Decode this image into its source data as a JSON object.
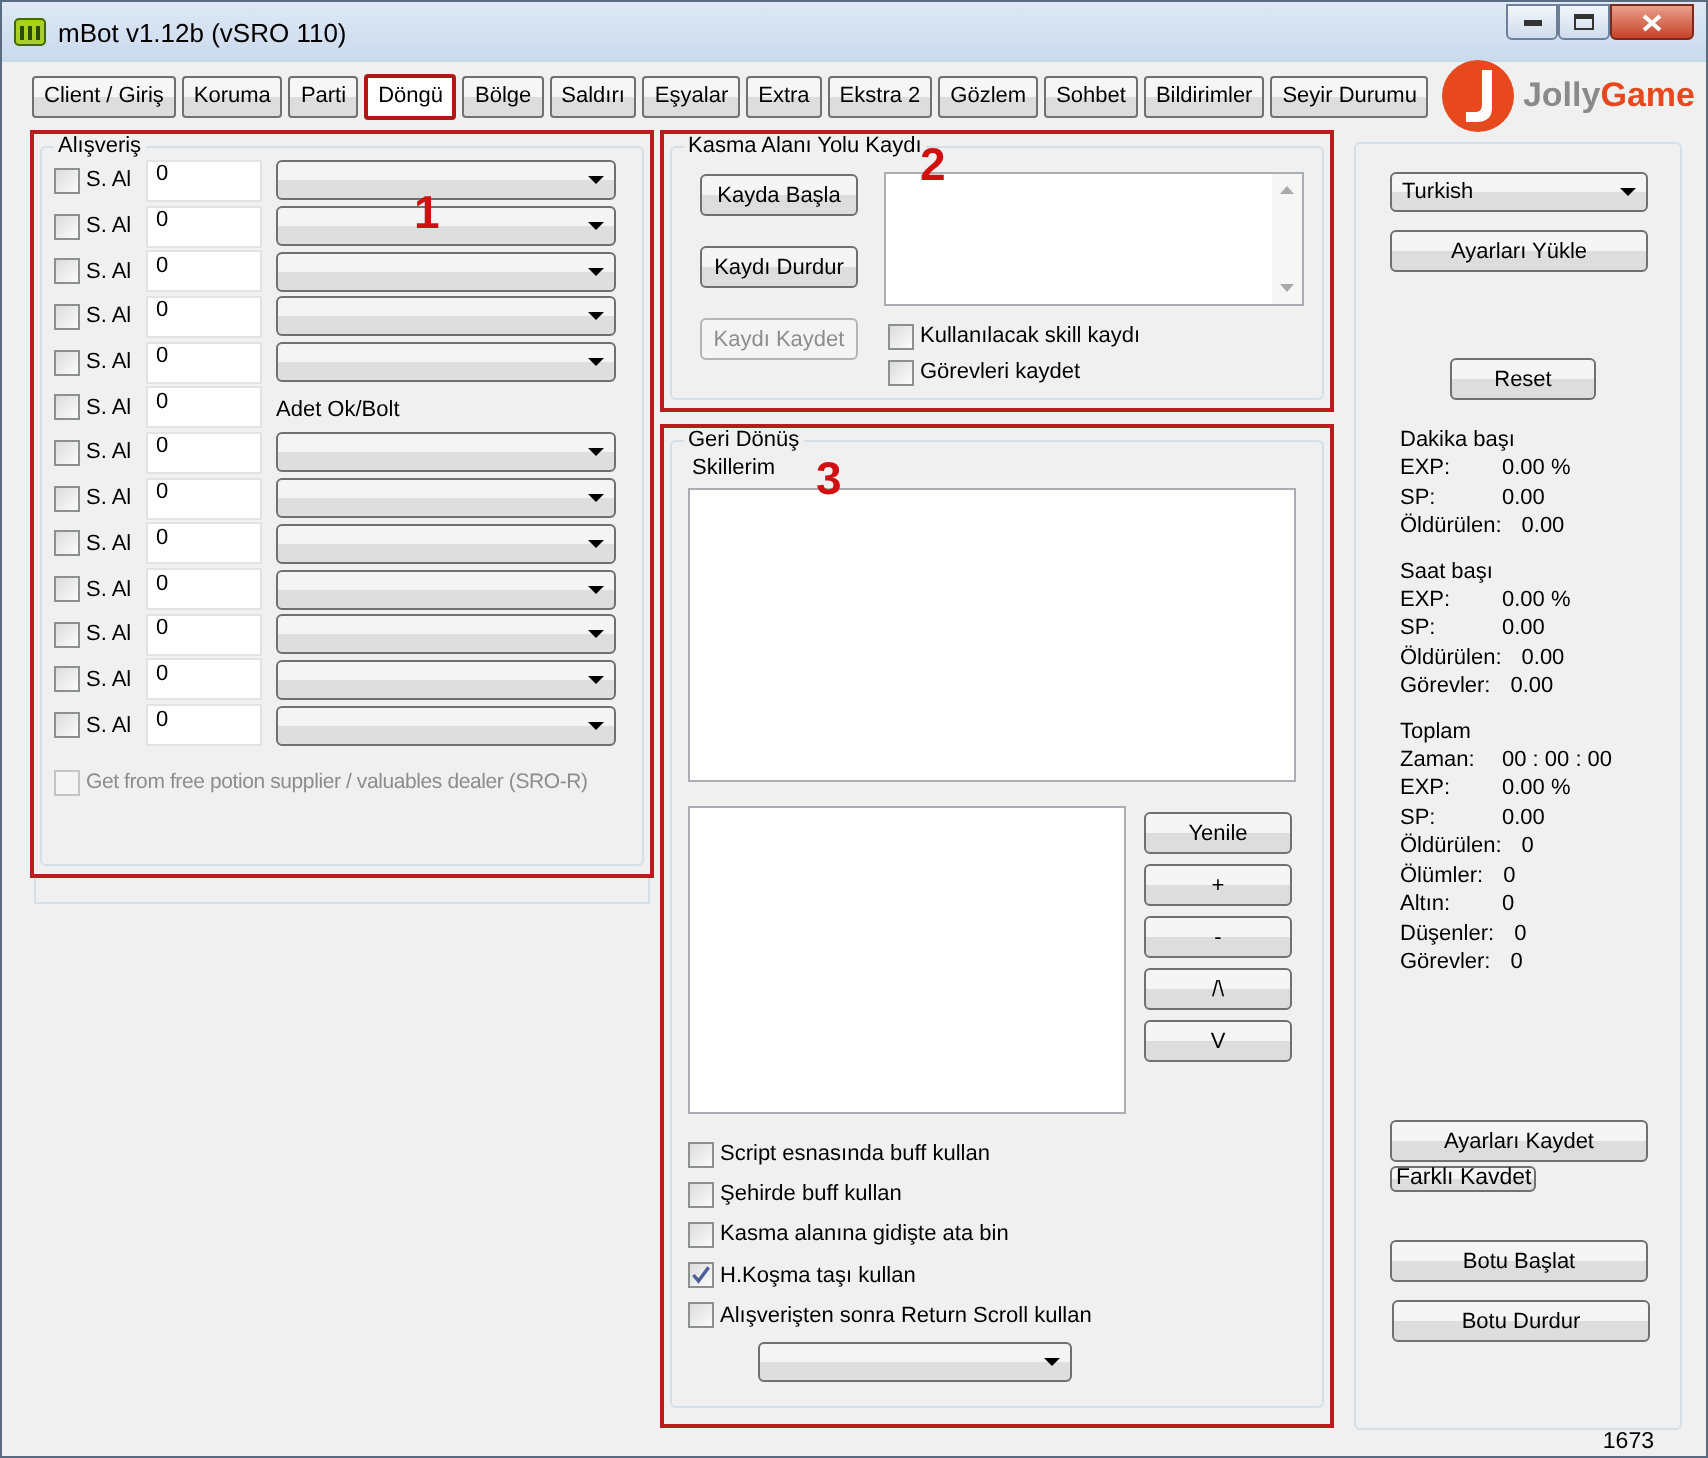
{
  "window": {
    "title": "mBot v1.12b (vSRO 110)"
  },
  "tabs": [
    {
      "label": "Client / Giriş",
      "selected": false
    },
    {
      "label": "Koruma",
      "selected": false
    },
    {
      "label": "Parti",
      "selected": false
    },
    {
      "label": "Döngü",
      "selected": true
    },
    {
      "label": "Bölge",
      "selected": false
    },
    {
      "label": "Saldırı",
      "selected": false
    },
    {
      "label": "Eşyalar",
      "selected": false
    },
    {
      "label": "Extra",
      "selected": false
    },
    {
      "label": "Ekstra 2",
      "selected": false
    },
    {
      "label": "Gözlem",
      "selected": false
    },
    {
      "label": "Sohbet",
      "selected": false
    },
    {
      "label": "Bildirimler",
      "selected": false
    },
    {
      "label": "Seyir Durumu",
      "selected": false
    }
  ],
  "logo": {
    "first": "Jolly",
    "second": "Game"
  },
  "shopping": {
    "title": "Alışveriş",
    "annotation": "1",
    "rows": [
      {
        "kind": "dropdown",
        "label": "S. Al",
        "checked": false,
        "value": "0"
      },
      {
        "kind": "dropdown",
        "label": "S. Al",
        "checked": false,
        "value": "0"
      },
      {
        "kind": "dropdown",
        "label": "S. Al",
        "checked": false,
        "value": "0"
      },
      {
        "kind": "dropdown",
        "label": "S. Al",
        "checked": false,
        "value": "0"
      },
      {
        "kind": "dropdown",
        "label": "S. Al",
        "checked": false,
        "value": "0"
      },
      {
        "kind": "caption",
        "label": "S. Al",
        "checked": false,
        "value": "0",
        "caption": "Adet Ok/Bolt"
      },
      {
        "kind": "dropdown",
        "label": "S. Al",
        "checked": false,
        "value": "0"
      },
      {
        "kind": "dropdown",
        "label": "S. Al",
        "checked": false,
        "value": "0"
      },
      {
        "kind": "dropdown",
        "label": "S. Al",
        "checked": false,
        "value": "0"
      },
      {
        "kind": "dropdown",
        "label": "S. Al",
        "checked": false,
        "value": "0"
      },
      {
        "kind": "dropdown",
        "label": "S. Al",
        "checked": false,
        "value": "0"
      },
      {
        "kind": "dropdown",
        "label": "S. Al",
        "checked": false,
        "value": "0"
      },
      {
        "kind": "dropdown",
        "label": "S. Al",
        "checked": false,
        "value": "0"
      }
    ],
    "free_supplier": {
      "label": "Get from free potion supplier / valuables dealer (SRO-R)",
      "checked": false,
      "disabled": true
    }
  },
  "route": {
    "title": "Kasma Alanı Yolu Kaydı",
    "annotation": "2",
    "buttons": [
      {
        "label": "Kayda Başla",
        "disabled": false
      },
      {
        "label": "Kaydı Durdur",
        "disabled": false
      },
      {
        "label": "Kaydı Kaydet",
        "disabled": true
      }
    ],
    "options": [
      {
        "label": "Kullanılacak skill kaydı",
        "checked": false
      },
      {
        "label": "Görevleri kaydet",
        "checked": false
      }
    ]
  },
  "return": {
    "title": "Geri Dönüş",
    "annotation": "3",
    "skills_label": "Skillerim",
    "buttons": [
      "Yenile",
      "+",
      "-",
      "/\\",
      "V"
    ],
    "options": [
      {
        "label": "Script esnasında buff kullan",
        "checked": false
      },
      {
        "label": "Şehirde buff kullan",
        "checked": false
      },
      {
        "label": "Kasma alanına gidişte ata bin",
        "checked": false
      },
      {
        "label": "H.Koşma taşı kullan",
        "checked": true
      },
      {
        "label": "Alışverişten sonra Return Scroll kullan",
        "checked": false
      }
    ]
  },
  "side": {
    "language": "Turkish",
    "load_button": "Ayarları Yükle",
    "reset_button": "Reset",
    "stats": [
      {
        "title": "Dakika başı",
        "rows": [
          {
            "label": "EXP:",
            "value": "0.00 %"
          },
          {
            "label": "SP:",
            "value": "0.00"
          },
          {
            "label": "Öldürülen:",
            "value": "0.00"
          }
        ]
      },
      {
        "title": "Saat başı",
        "rows": [
          {
            "label": "EXP:",
            "value": "0.00 %"
          },
          {
            "label": "SP:",
            "value": "0.00"
          },
          {
            "label": "Öldürülen:",
            "value": "0.00"
          },
          {
            "label": "Görevler:",
            "value": "0.00"
          }
        ]
      },
      {
        "title": "Toplam",
        "rows": [
          {
            "label": "Zaman:",
            "value": "00 : 00 : 00"
          },
          {
            "label": "EXP:",
            "value": "0.00 %"
          },
          {
            "label": "SP:",
            "value": "0.00"
          },
          {
            "label": "Öldürülen:",
            "value": "0"
          },
          {
            "label": "Ölümler:",
            "value": "0"
          },
          {
            "label": "Altın:",
            "value": "0"
          },
          {
            "label": "Düşenler:",
            "value": "0"
          },
          {
            "label": "Görevler:",
            "value": "0"
          }
        ]
      }
    ],
    "save_button": "Ayarları Kaydet",
    "save_as_button": "Farklı Kavdet",
    "start_button": "Botu Başlat",
    "stop_button": "Botu Durdur"
  },
  "status_bar": {
    "text": "1673"
  }
}
